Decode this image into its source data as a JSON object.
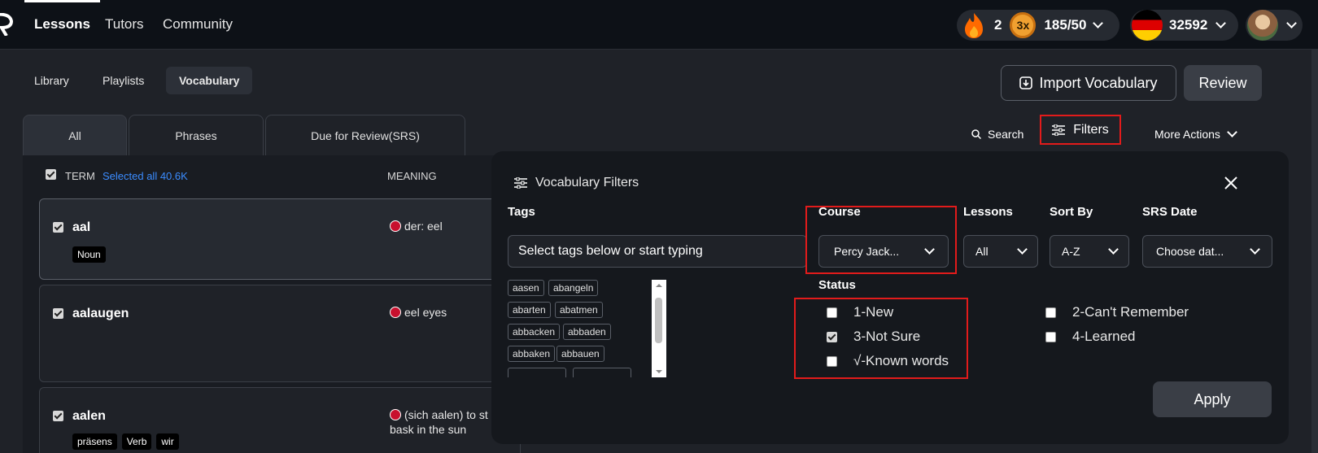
{
  "nav": {
    "lessons": "Lessons",
    "tutors": "Tutors",
    "community": "Community"
  },
  "stats": {
    "streak": "2",
    "multiplier": "3x",
    "xp": "185/50",
    "points": "32592"
  },
  "tabs": {
    "library": "Library",
    "playlists": "Playlists",
    "vocabulary": "Vocabulary"
  },
  "buttons": {
    "import": "Import Vocabulary",
    "review": "Review"
  },
  "subtabs": {
    "all": "All",
    "phrases": "Phrases",
    "due": "Due for Review(SRS)"
  },
  "actions": {
    "search": "Search",
    "filters": "Filters",
    "more": "More Actions"
  },
  "table": {
    "term_header": "TERM",
    "selected": "Selected all 40.6K",
    "meaning_header": "MEANING",
    "rows": [
      {
        "term": "aal",
        "meaning": "der: eel",
        "meaning2": "",
        "tags": [
          "Noun"
        ]
      },
      {
        "term": "aalaugen",
        "meaning": "eel eyes",
        "meaning2": "",
        "tags": []
      },
      {
        "term": "aalen",
        "meaning": "(sich aalen) to st",
        "meaning2": "bask in the sun",
        "tags": [
          "präsens",
          "Verb",
          "wir"
        ]
      }
    ]
  },
  "filters": {
    "title": "Vocabulary Filters",
    "tags_label": "Tags",
    "tags_placeholder": "Select tags below or start typing",
    "tag_chips": [
      "aasen",
      "abangeln",
      "abarten",
      "abatmen",
      "abbacken",
      "abbaden",
      "abbaken",
      "abbauen"
    ],
    "course_label": "Course",
    "course_value": "Percy Jack...",
    "lessons_label": "Lessons",
    "lessons_value": "All",
    "sort_label": "Sort By",
    "sort_value": "A-Z",
    "srs_label": "SRS Date",
    "srs_value": "Choose dat...",
    "status_label": "Status",
    "status_options": [
      {
        "label": "1-New",
        "checked": false
      },
      {
        "label": "3-Not Sure",
        "checked": true
      },
      {
        "label": "√-Known words",
        "checked": false
      },
      {
        "label": "2-Can't Remember",
        "checked": false
      },
      {
        "label": "4-Learned",
        "checked": false
      }
    ],
    "apply": "Apply"
  },
  "colors": {
    "highlight": "#e21b1b",
    "link": "#3b8cff",
    "flame": "#ff6a00"
  }
}
